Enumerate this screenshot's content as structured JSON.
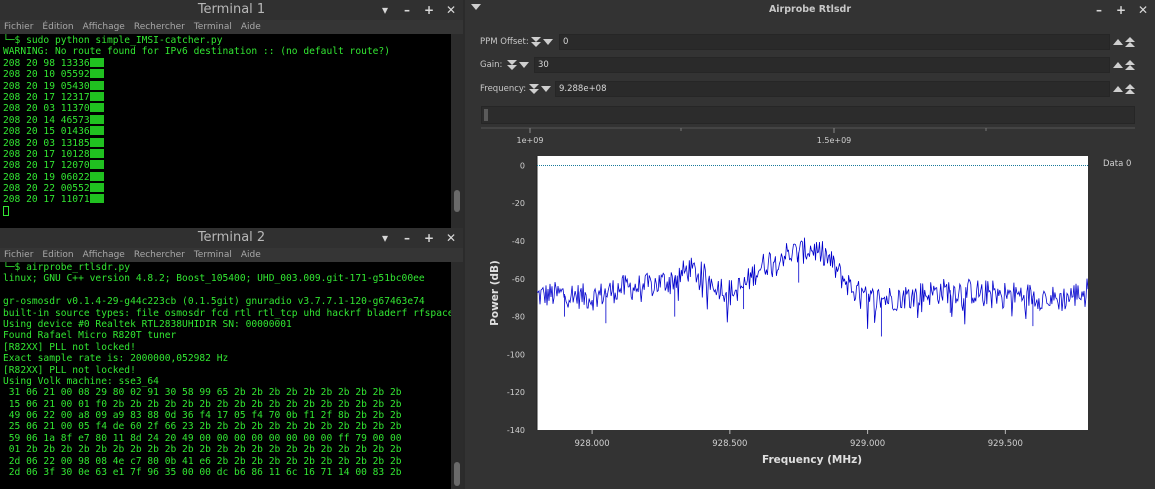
{
  "terminal1": {
    "title": "Terminal 1",
    "menu": [
      "Fichier",
      "Édition",
      "Affichage",
      "Rechercher",
      "Terminal",
      "Aide"
    ],
    "lines": [
      "└─$ sudo python simple_IMSI-catcher.py",
      "WARNING: No route found for IPv6 destination :: (no default route?)",
      "208 20 98 13336",
      "208 20 10 05592",
      "208 20 19 05430",
      "208 20 17 12317",
      "208 20 03 11370",
      "208 20 14 46573",
      "208 20 15 01436",
      "208 20 03 13185",
      "208 20 17 10128",
      "208 20 17 12070",
      "208 20 19 06022",
      "208 20 22 00552",
      "208 20 17 11071"
    ]
  },
  "terminal2": {
    "title": "Terminal 2",
    "menu": [
      "Fichier",
      "Edition",
      "Affichage",
      "Rechercher",
      "Terminal",
      "Aide"
    ],
    "lines": [
      "└─$ airprobe_rtlsdr.py",
      "linux; GNU C++ version 4.8.2; Boost_105400; UHD_003.009.git-171-g51bc00ee",
      "",
      "gr-osmosdr v0.1.4-29-g44c223cb (0.1.5git) gnuradio v3.7.7.1-120-g67463e74",
      "built-in source types: file osmosdr fcd rtl rtl_tcp uhd hackrf bladerf rfspace",
      "Using device #0 Realtek RTL2838UHIDIR SN: 00000001",
      "Found Rafael Micro R820T tuner",
      "[R82XX] PLL not locked!",
      "Exact sample rate is: 2000000,052982 Hz",
      "[R82XX] PLL not locked!",
      "Using Volk machine: sse3_64",
      " 31 06 21 00 08 29 80 02 91 30 58 99 65 2b 2b 2b 2b 2b 2b 2b 2b 2b 2b",
      " 15 06 21 00 01 f0 2b 2b 2b 2b 2b 2b 2b 2b 2b 2b 2b 2b 2b 2b 2b 2b 2b",
      " 49 06 22 00 a8 09 a9 83 88 0d 36 f4 17 05 f4 70 0b f1 2f 8b 2b 2b 2b",
      " 25 06 21 00 05 f4 de 60 2f 66 23 2b 2b 2b 2b 2b 2b 2b 2b 2b 2b 2b 2b",
      " 59 06 1a 8f e7 80 11 8d 24 20 49 00 00 00 00 00 00 00 00 ff 79 00 00",
      " 01 2b 2b 2b 2b 2b 2b 2b 2b 2b 2b 2b 2b 2b 2b 2b 2b 2b 2b 2b 2b 2b 2b",
      " 2d 06 22 00 98 08 4e c7 80 0b 41 e6 2b 2b 2b 2b 2b 2b 2b 2b 2b 2b 2b",
      " 2d 06 3f 30 0e 63 e1 7f 96 35 00 00 dc b6 86 11 6c 16 71 14 00 83 2b"
    ]
  },
  "airprobe": {
    "title": "Airprobe Rtlsdr",
    "ppm_label": "PPM Offset:",
    "ppm_value": "0",
    "gain_label": "Gain:",
    "gain_value": "30",
    "freq_label": "Frequency:",
    "freq_value": "9.288e+08",
    "slider_ticks": [
      "1e+09",
      "1.5e+09"
    ]
  },
  "chart_data": {
    "type": "line",
    "title": "",
    "xlabel": "Frequency (MHz)",
    "ylabel": "Power (dB)",
    "xlim": [
      927.8,
      929.8
    ],
    "ylim": [
      -140,
      5
    ],
    "x_ticks": [
      "928.000",
      "928.500",
      "929.000",
      "929.500"
    ],
    "x_tick_values": [
      928.0,
      928.5,
      929.0,
      929.5
    ],
    "y_ticks": [
      0,
      -20,
      -40,
      -60,
      -80,
      -100,
      -120,
      -140
    ],
    "series": [
      {
        "name": "Data 0",
        "color": "#0000cc",
        "x": [
          927.8,
          927.9,
          928.0,
          928.1,
          928.2,
          928.3,
          928.35,
          928.4,
          928.45,
          928.5,
          928.55,
          928.6,
          928.65,
          928.7,
          928.75,
          928.8,
          928.85,
          928.9,
          928.95,
          929.0,
          929.1,
          929.2,
          929.3,
          929.4,
          929.5,
          929.6,
          929.7,
          929.8
        ],
        "values": [
          -69,
          -68,
          -70,
          -65,
          -64,
          -60,
          -55,
          -58,
          -63,
          -67,
          -64,
          -55,
          -50,
          -47,
          -46,
          -44,
          -48,
          -58,
          -66,
          -71,
          -70,
          -68,
          -66,
          -67,
          -68,
          -69,
          -71,
          -66
        ]
      }
    ],
    "reference_line": 0,
    "legend": "Data 0",
    "legend_position": "top-right",
    "grid": false
  }
}
